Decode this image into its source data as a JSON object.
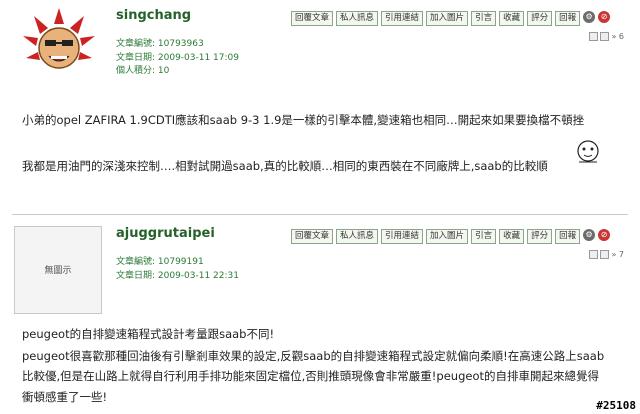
{
  "toolbar_labels": [
    "回覆文章",
    "私人訊息",
    "引用連結",
    "加入圖片",
    "引言",
    "收藏",
    "評分",
    "回報"
  ],
  "posts": [
    {
      "username": "singchang",
      "meta": [
        "文章編號: 10793963",
        "文章日期: 2009-03-11 17:09",
        "個人積分: 10"
      ],
      "floor": "» 6",
      "body": [
        "小弟的opel ZAFIRA 1.9CDTI應該和saab 9-3 1.9是一樣的引擊本體,變速箱也相同…開起來如果要換檔不頓挫",
        "我都是用油門的深淺來控制….相對試開過saab,真的比較順…相同的東西裝在不同廠牌上,saab的比較順"
      ]
    },
    {
      "username": "ajuggrutaipei",
      "avatar_text": "無圖示",
      "meta": [
        "文章編號: 10799191",
        "文章日期: 2009-03-11 22:31"
      ],
      "floor": "» 7",
      "body": [
        "peugeot的自排變速箱程式設計考量跟saab不同!",
        "peugeot很喜歡那種回油後有引擊剎車效果的設定,反觀saab的自排變速箱程式設定就偏向柔順!在高速公路上saab",
        "比較優,但是在山路上就得自行利用手排功能來固定檔位,否則推頭現像會非常嚴重!peugeot的自排車開起來總覺得",
        "衝頓感重了一些!"
      ]
    }
  ],
  "watermark": "#25108"
}
